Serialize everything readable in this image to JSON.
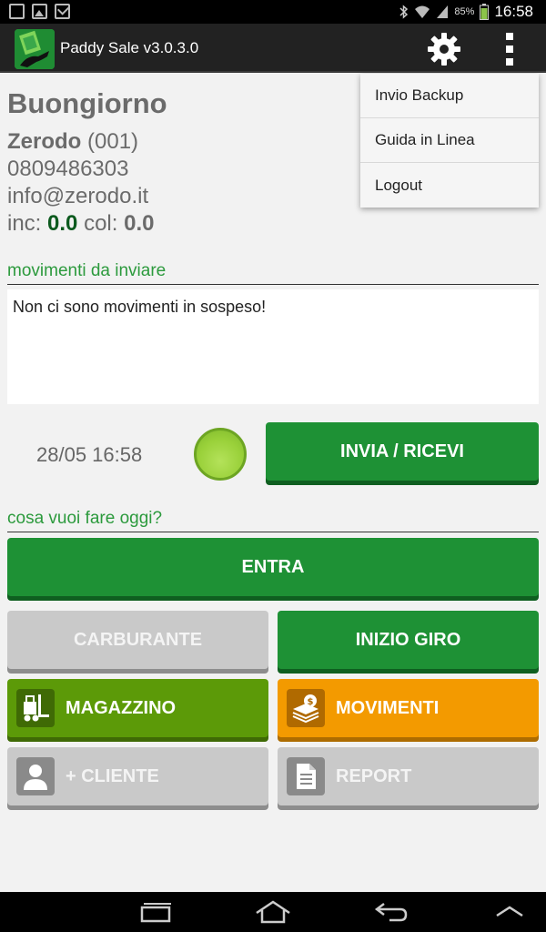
{
  "statusbar": {
    "battery": "85%",
    "time": "16:58"
  },
  "app": {
    "title": "Paddy Sale v3.0.3.0"
  },
  "greeting": "Buongiorno",
  "user": {
    "name": "Zerodo",
    "code": "(001)",
    "phone": "0809486303",
    "email": "info@zerodo.it",
    "inc_label": "inc:",
    "inc_value": "0.0",
    "col_label": "col:",
    "col_value": "0.0"
  },
  "pending": {
    "title": "movimenti da inviare",
    "message": "Non ci sono movimenti in sospeso!"
  },
  "sync": {
    "last_sync": "28/05 16:58",
    "button": "INVIA / RICEVI",
    "led_color": "#9ad13a"
  },
  "actions": {
    "title": "cosa vuoi fare oggi?",
    "enter": "ENTRA",
    "fuel": "CARBURANTE",
    "start_tour": "INIZIO GIRO",
    "warehouse": "MAGAZZINO",
    "movements": "MOVIMENTI",
    "add_client": "+ CLIENTE",
    "report": "REPORT"
  },
  "menu": {
    "items": [
      "Invio Backup",
      "Guida in Linea",
      "Logout"
    ]
  },
  "colors": {
    "green": "#1e9135",
    "olive": "#5c9a08",
    "orange": "#f39a00",
    "gray": "#c9c9c9",
    "accent_text": "#2c9a3d"
  },
  "icons": [
    "settings-gear-icon",
    "overflow-menu-icon",
    "forklift-icon",
    "money-stack-icon",
    "person-icon",
    "document-icon",
    "recent-apps-icon",
    "home-icon",
    "back-icon",
    "chevron-up-icon"
  ]
}
